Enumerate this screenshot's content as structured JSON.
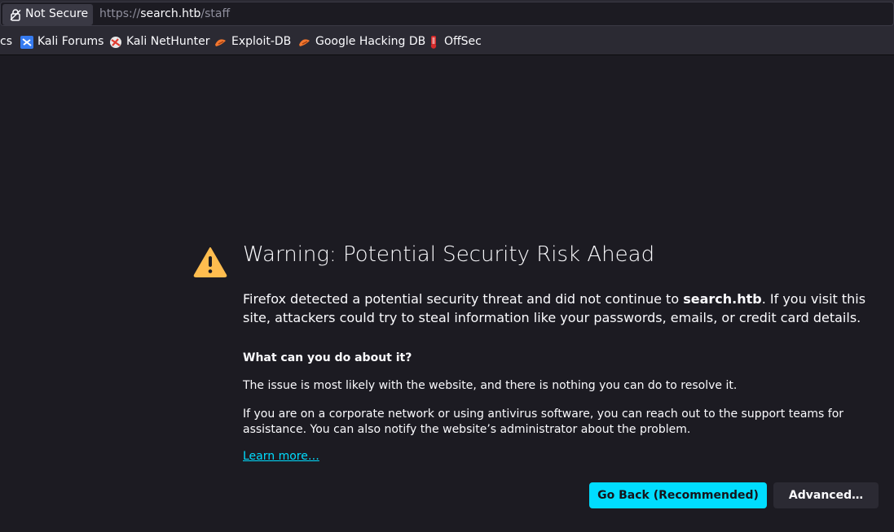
{
  "urlbar": {
    "identity_label": "Not Secure",
    "url_scheme": "https://",
    "url_host": "search.htb",
    "url_path": "/staff"
  },
  "bookmarks": {
    "items": [
      {
        "label": "cs",
        "icon": "none"
      },
      {
        "label": "Kali Forums",
        "icon": "kali-forums-icon"
      },
      {
        "label": "Kali NetHunter",
        "icon": "kali-nethunter-icon"
      },
      {
        "label": "Exploit-DB",
        "icon": "exploit-db-icon"
      },
      {
        "label": "Google Hacking DB",
        "icon": "exploit-db-icon"
      },
      {
        "label": "OffSec",
        "icon": "offsec-icon"
      }
    ]
  },
  "error_page": {
    "title": "Warning: Potential Security Risk Ahead",
    "desc_before": "Firefox detected a potential security threat and did not continue to ",
    "desc_host": "search.htb",
    "desc_after": ". If you visit this site, attackers could try to steal information like your passwords, emails, or credit card details.",
    "subheading": "What can you do about it?",
    "para1": "The issue is most likely with the website, and there is nothing you can do to resolve it.",
    "para2": "If you are on a corporate network or using antivirus software, you can reach out to the support teams for assistance. You can also notify the website’s administrator about the problem.",
    "learn_more": "Learn more…",
    "go_back_label": "Go Back (Recommended)",
    "advanced_label": "Advanced…"
  },
  "colors": {
    "accent": "#00ddff",
    "warning": "#ffbd4f",
    "background": "#1c1b22"
  }
}
